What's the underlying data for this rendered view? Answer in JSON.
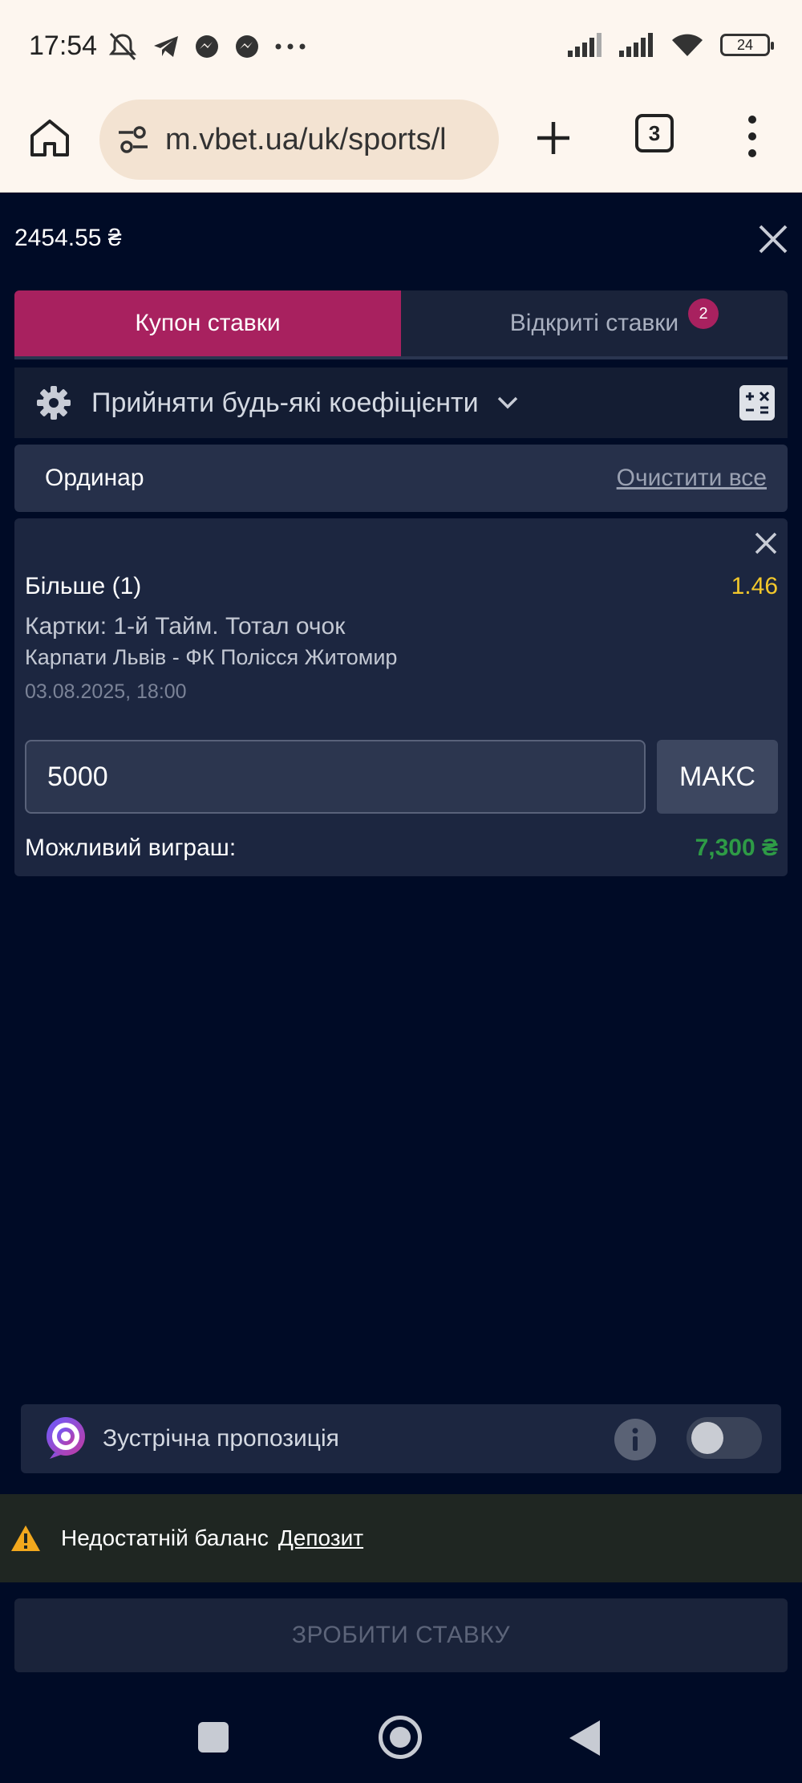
{
  "status_bar": {
    "time": "17:54",
    "icons_left": [
      "mute-icon",
      "telegram-icon",
      "messenger-icon",
      "messenger-icon",
      "more-dots-icon"
    ],
    "icons_right": [
      "signal-icon",
      "signal-icon",
      "wifi-icon",
      "battery-icon"
    ],
    "battery": "24"
  },
  "browser": {
    "url": "m.vbet.ua/uk/sports/l",
    "tab_count": "3"
  },
  "header": {
    "balance": "2454.55 ₴"
  },
  "tabs": {
    "coupon": "Купон ставки",
    "open_bets": "Відкриті ставки",
    "open_bets_badge": "2"
  },
  "odds_setting": {
    "label": "Прийняти будь-які коефіцієнти"
  },
  "bet_type": {
    "label": "Ординар",
    "clear_all": "Очистити все"
  },
  "bet": {
    "selection": "Більше (1)",
    "odds": "1.46",
    "market": "Картки: 1-й Тайм. Тотал очок",
    "match": "Карпати Львів - ФК Полісся Житомир",
    "datetime": "03.08.2025, 18:00",
    "stake": "5000",
    "max_label": "МАКС",
    "possible_win_label": "Можливий виграш:",
    "possible_win_value": "7,300 ₴"
  },
  "counter_offer": {
    "label": "Зустрічна пропозиція",
    "enabled": false
  },
  "warning": {
    "text": "Недостатній баланс",
    "link": "Депозит"
  },
  "place_bet": {
    "label": "ЗРОБИТИ СТАВКУ"
  },
  "colors": {
    "background": "#000b26",
    "accent": "#a8215f",
    "odds": "#f2c72b",
    "win": "#2e9b46"
  }
}
